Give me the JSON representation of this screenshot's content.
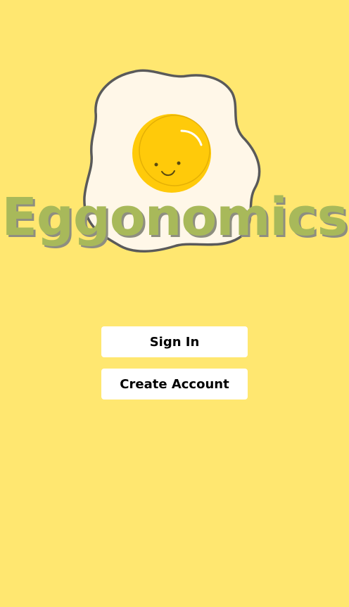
{
  "app": {
    "name": "Eggonomics",
    "logo_icon": "fried-egg-icon"
  },
  "actions": {
    "sign_in_label": "Sign In",
    "create_account_label": "Create Account"
  },
  "colors": {
    "background": "#FFE770",
    "wordmark": "#A8B95A",
    "wordmark_shadow": "#8E8E80",
    "egg_white": "#FFF7E8",
    "yolk": "#FFCA0A",
    "outline": "#5A5A5A",
    "button_bg": "#FFFFFF",
    "button_text": "#000000"
  }
}
